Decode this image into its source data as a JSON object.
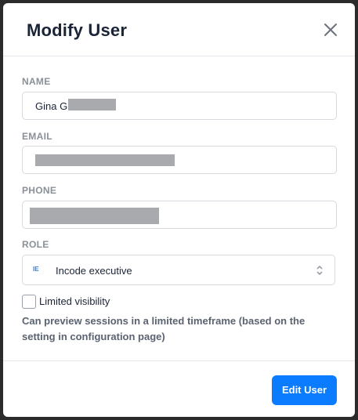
{
  "dialog": {
    "title": "Modify User",
    "close_icon": "close-icon"
  },
  "fields": {
    "name": {
      "label": "NAME",
      "value": "Gina G"
    },
    "email": {
      "label": "EMAIL",
      "value": ""
    },
    "phone": {
      "label": "PHONE",
      "value": ""
    },
    "role": {
      "label": "ROLE",
      "badge": "IE",
      "value": "Incode executive",
      "icon": "updown-chevron-icon"
    }
  },
  "limited_visibility": {
    "label": "Limited visibility",
    "checked": false,
    "help": "Can preview sessions in a limited timeframe (based on the setting in configuration page)"
  },
  "footer": {
    "submit_label": "Edit User"
  },
  "colors": {
    "primary": "#0b7cff",
    "badge": "#2a7cf6",
    "title": "#1b2437",
    "label": "#8a9099"
  }
}
